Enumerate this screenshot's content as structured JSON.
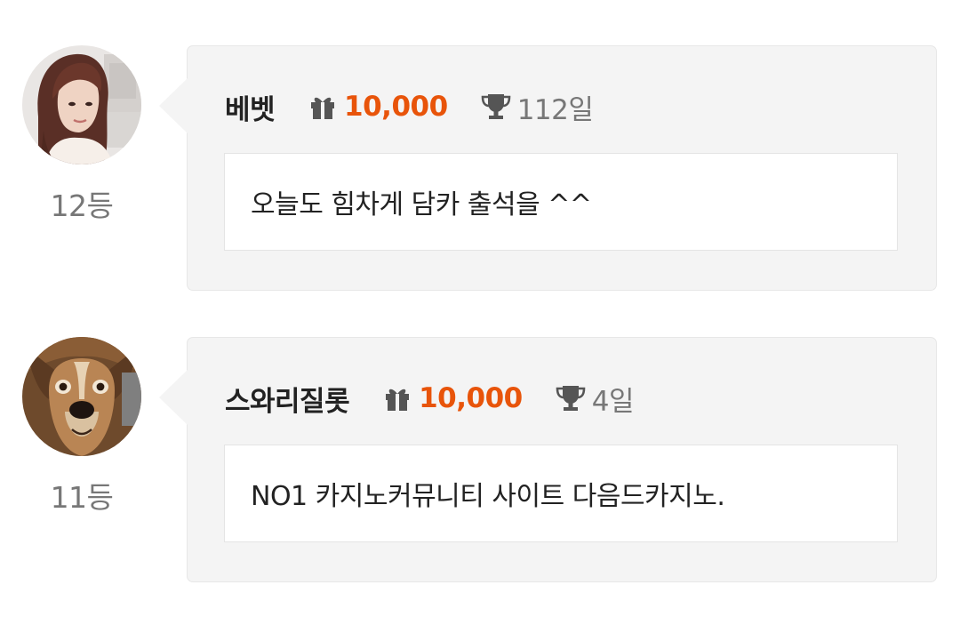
{
  "colors": {
    "points": "#e8540a",
    "card_background": "#f4f4f4",
    "muted_text": "#777777",
    "username_text": "#222222"
  },
  "icons": {
    "gift": "gift-icon",
    "trophy": "trophy-icon"
  },
  "comments": [
    {
      "rank": "12등",
      "username": "베벳",
      "points": "10,000",
      "days": "112일",
      "text": "오늘도 힘차게 담카 출석을 ^^",
      "avatar": "avatar-woman-photo"
    },
    {
      "rank": "11등",
      "username": "스와리질롯",
      "points": "10,000",
      "days": "4일",
      "text": "NO1 카지노커뮤니티 사이트 다음드카지노.",
      "avatar": "avatar-dog-photo"
    }
  ]
}
